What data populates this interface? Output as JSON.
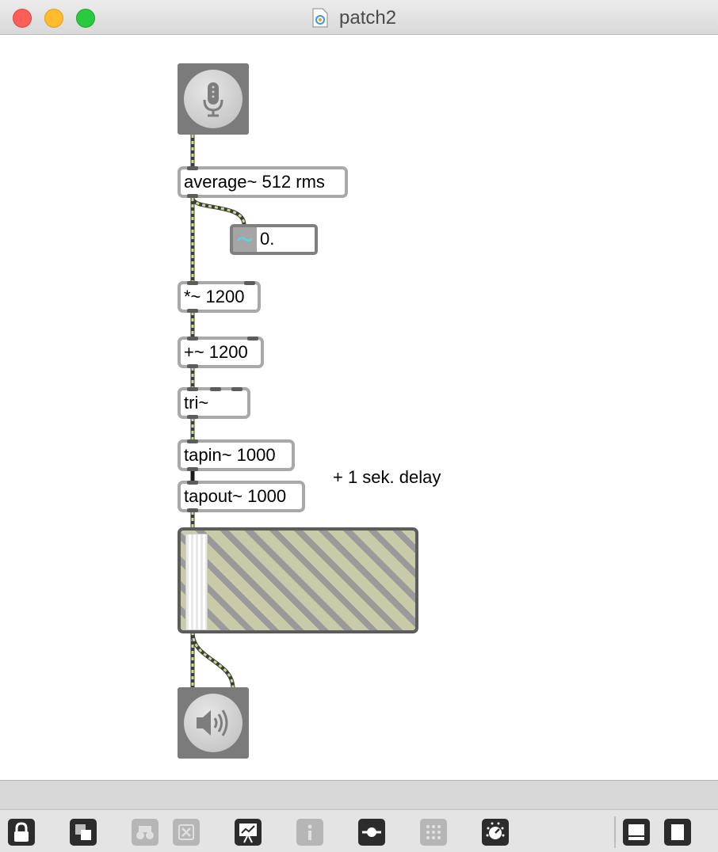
{
  "window": {
    "title": "patch2"
  },
  "patch": {
    "objects": {
      "average": "average~ 512 rms",
      "mult": "*~ 1200",
      "add": "+~ 1200",
      "tri": "tri~",
      "tapin": "tapin~ 1000",
      "tapout": "tapout~ 1000"
    },
    "number_display": {
      "value": "0."
    },
    "comment": "+ 1 sek. delay",
    "ezadc_icon": "microphone-icon",
    "ezdac_icon": "speaker-icon",
    "gain_level": 0.1
  },
  "colors": {
    "patch_cord_signal": "#c6df8a",
    "object_border": "#a9a9a9",
    "gain_stripe": "#c9caa7"
  },
  "toolbar": {
    "buttons": [
      {
        "icon": "lock-icon",
        "enabled": true
      },
      {
        "icon": "presentation-mode-icon",
        "enabled": true
      },
      {
        "icon": "binoculars-icon",
        "enabled": false
      },
      {
        "icon": "clear-icon",
        "enabled": false
      },
      {
        "icon": "easel-icon",
        "enabled": true
      },
      {
        "icon": "info-icon",
        "enabled": false
      },
      {
        "icon": "slider-icon",
        "enabled": true
      },
      {
        "icon": "grid-icon",
        "enabled": false
      },
      {
        "icon": "dial-icon",
        "enabled": true
      },
      {
        "icon": "bottom-panel-icon",
        "enabled": true
      },
      {
        "icon": "sidebar-icon",
        "enabled": true
      }
    ]
  }
}
